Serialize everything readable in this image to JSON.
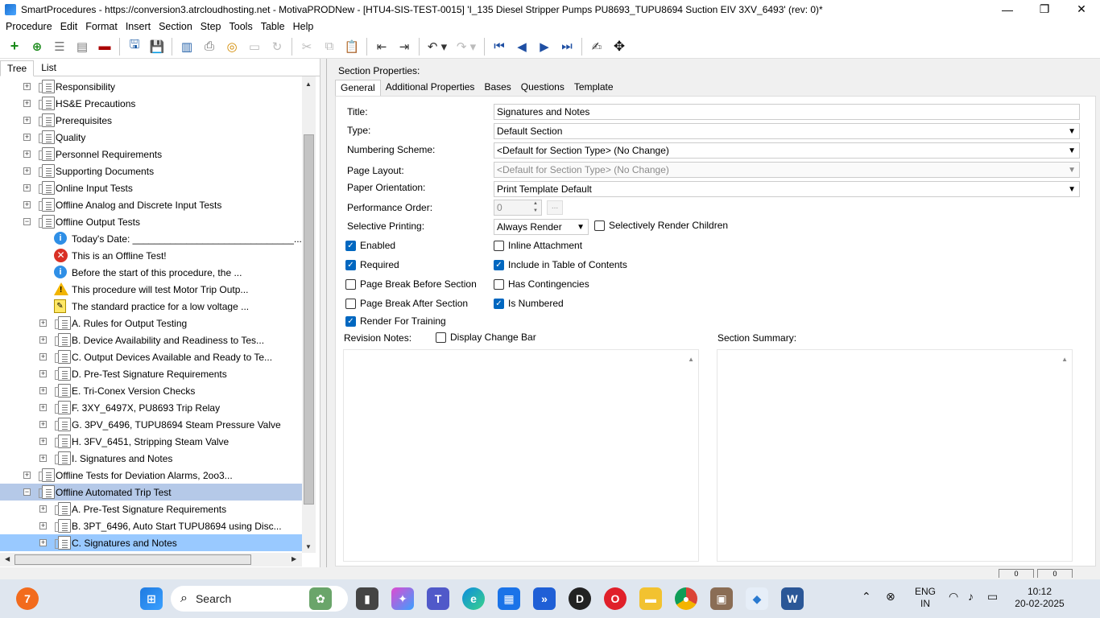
{
  "window": {
    "title": "SmartProcedures - https://conversion3.atrcloudhosting.net - MotivaPRODNew - [HTU4-SIS-TEST-0015] 'I_135 Diesel Stripper Pumps PU8693_TUPU8694 Suction EIV 3XV_6493' (rev: 0)*",
    "minimize": "—",
    "maximize": "❐",
    "close": "✕"
  },
  "menu": [
    "Procedure",
    "Edit",
    "Format",
    "Insert",
    "Section",
    "Step",
    "Tools",
    "Table",
    "Help"
  ],
  "left_tabs": [
    "Tree",
    "List"
  ],
  "tree": [
    {
      "label": "Responsibility",
      "level": 0,
      "icon": "doc",
      "exp": "+"
    },
    {
      "label": "HS&E Precautions",
      "level": 0,
      "icon": "doc",
      "exp": "+"
    },
    {
      "label": "Prerequisites",
      "level": 0,
      "icon": "doc",
      "exp": "+"
    },
    {
      "label": "Quality",
      "level": 0,
      "icon": "doc",
      "exp": "+"
    },
    {
      "label": "Personnel Requirements",
      "level": 0,
      "icon": "doc",
      "exp": "+"
    },
    {
      "label": "Supporting Documents",
      "level": 0,
      "icon": "doc",
      "exp": "+"
    },
    {
      "label": "Online Input Tests",
      "level": 0,
      "icon": "doc",
      "exp": "+"
    },
    {
      "label": "Offline Analog and Discrete Input Tests",
      "level": 0,
      "icon": "doc",
      "exp": "+"
    },
    {
      "label": "Offline Output Tests",
      "level": 0,
      "icon": "doc",
      "exp": "−"
    },
    {
      "label": "Today's Date: ______________________________...",
      "level": 1,
      "icon": "info",
      "exp": ""
    },
    {
      "label": "This is an Offline Test!",
      "level": 1,
      "icon": "error",
      "exp": ""
    },
    {
      "label": "Before the start of this procedure, the ...",
      "level": 1,
      "icon": "info",
      "exp": ""
    },
    {
      "label": "This procedure will test Motor Trip Outp...",
      "level": 1,
      "icon": "warning",
      "exp": ""
    },
    {
      "label": "The standard practice for a low voltage ...",
      "level": 1,
      "icon": "note",
      "exp": ""
    },
    {
      "label": "A. Rules for Output Testing",
      "level": 1,
      "icon": "doc",
      "exp": "+"
    },
    {
      "label": "B. Device Availability and Readiness to Tes...",
      "level": 1,
      "icon": "doc",
      "exp": "+"
    },
    {
      "label": "C. Output Devices Available and Ready to Te...",
      "level": 1,
      "icon": "doc",
      "exp": "+"
    },
    {
      "label": "D. Pre-Test Signature Requirements",
      "level": 1,
      "icon": "doc",
      "exp": "+"
    },
    {
      "label": "E. Tri-Conex Version Checks",
      "level": 1,
      "icon": "doc",
      "exp": "+"
    },
    {
      "label": "F. 3XY_6497X, PU8693 Trip Relay",
      "level": 1,
      "icon": "doc",
      "exp": "+"
    },
    {
      "label": "G. 3PV_6496, TUPU8694 Steam Pressure Valve",
      "level": 1,
      "icon": "doc",
      "exp": "+"
    },
    {
      "label": "H. 3FV_6451, Stripping Steam Valve",
      "level": 1,
      "icon": "doc",
      "exp": "+"
    },
    {
      "label": "I. Signatures and Notes",
      "level": 1,
      "icon": "doc",
      "exp": "+"
    },
    {
      "label": "Offline Tests for Deviation Alarms, 2oo3...",
      "level": 0,
      "icon": "doc",
      "exp": "+"
    },
    {
      "label": "Offline Automated Trip Test",
      "level": 0,
      "icon": "doc",
      "exp": "−",
      "state": "selected-parent"
    },
    {
      "label": "A. Pre-Test Signature Requirements",
      "level": 1,
      "icon": "doc",
      "exp": "+"
    },
    {
      "label": "B. 3PT_6496, Auto Start TUPU8694 using Disc...",
      "level": 1,
      "icon": "doc",
      "exp": "+"
    },
    {
      "label": "C. Signatures and Notes",
      "level": 1,
      "icon": "doc",
      "exp": "+",
      "state": "selected"
    }
  ],
  "right": {
    "header": "Section Properties:",
    "tabs": [
      "General",
      "Additional Properties",
      "Bases",
      "Questions",
      "Template"
    ],
    "labels": {
      "title": "Title:",
      "type": "Type:",
      "numbering": "Numbering Scheme:",
      "page_layout": "Page Layout:",
      "orientation": "Paper Orientation:",
      "perf_order": "Performance Order:",
      "selective": "Selective Printing:",
      "revision": "Revision Notes:",
      "summary": "Section Summary:"
    },
    "values": {
      "title": "Signatures and Notes",
      "type": "Default Section",
      "numbering": "<Default for Section Type> (No Change)",
      "page_layout": "<Default for Section Type> (No Change)",
      "orientation": "Print Template Default",
      "perf_order": "0",
      "perf_btn": "...",
      "selective": "Always Render"
    },
    "checkboxes": {
      "selectively_render_children": {
        "label": "Selectively Render Children",
        "checked": false
      },
      "enabled": {
        "label": "Enabled",
        "checked": true
      },
      "inline_attachment": {
        "label": "Inline Attachment",
        "checked": false
      },
      "required": {
        "label": "Required",
        "checked": true
      },
      "include_toc": {
        "label": "Include in Table of Contents",
        "checked": true
      },
      "page_break_before": {
        "label": "Page Break Before Section",
        "checked": false
      },
      "has_contingencies": {
        "label": "Has Contingencies",
        "checked": false
      },
      "page_break_after": {
        "label": "Page Break After Section",
        "checked": false
      },
      "is_numbered": {
        "label": "Is Numbered",
        "checked": true
      },
      "render_training": {
        "label": "Render For Training",
        "checked": true
      },
      "display_change_bar": {
        "label": "Display Change Bar",
        "checked": false
      }
    },
    "status_boxes": [
      "0",
      "0"
    ]
  },
  "taskbar": {
    "badge": "7",
    "search": "Search",
    "lang": "ENG",
    "region": "IN",
    "time": "10:12",
    "date": "20-02-2025"
  }
}
